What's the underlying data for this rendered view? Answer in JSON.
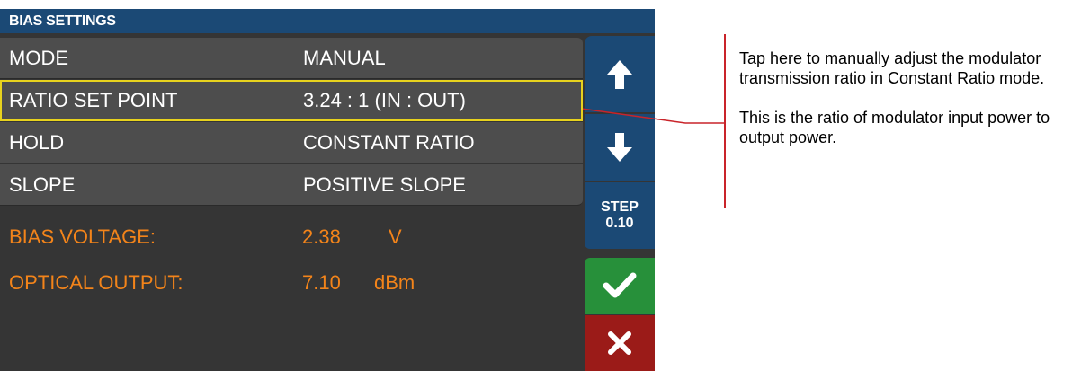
{
  "window": {
    "title": "BIAS SETTINGS"
  },
  "settings": [
    {
      "label": "MODE",
      "value": "MANUAL"
    },
    {
      "label": "RATIO SET POINT",
      "value": "3.24  : 1 (IN : OUT)"
    },
    {
      "label": "HOLD",
      "value": "CONSTANT RATIO"
    },
    {
      "label": "SLOPE",
      "value": "POSITIVE SLOPE"
    }
  ],
  "status": {
    "bias_label": "BIAS VOLTAGE:",
    "bias_value": "2.38",
    "bias_unit": "V",
    "optical_label": "OPTICAL OUTPUT:",
    "optical_value": "7.10",
    "optical_unit": "dBm"
  },
  "sidebar": {
    "step_label": "STEP",
    "step_value": "0.10",
    "up_icon": "arrow-up-icon",
    "down_icon": "arrow-down-icon",
    "ok_icon": "checkmark-icon",
    "cancel_icon": "close-icon"
  },
  "callout": {
    "text1": "Tap here to manually adjust the modulator transmission ratio in Constant Ratio mode.",
    "text2": "This is the ratio of modulator input power to output power."
  },
  "colors": {
    "titlebar": "#1b4975",
    "row_bg": "#4d4d4d",
    "panel_bg": "#353535",
    "highlight": "#e7d21d",
    "status_text": "#f3841a",
    "ok": "#27903a",
    "cancel": "#9b1b18",
    "callout": "#c9242a"
  }
}
